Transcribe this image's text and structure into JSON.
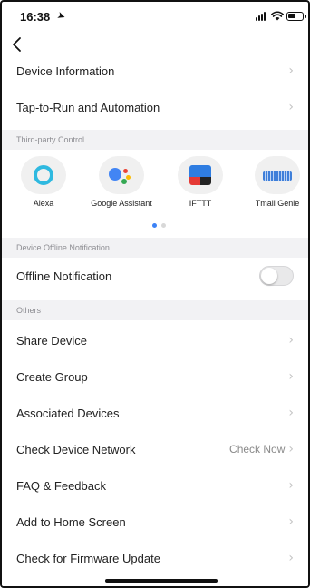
{
  "status_bar": {
    "time": "16:38",
    "location_icon": "location-arrow-icon",
    "signal_icon": "cellular-signal-icon",
    "wifi_icon": "wifi-icon",
    "battery_icon": "battery-icon"
  },
  "nav": {
    "back_icon": "chevron-left-icon"
  },
  "rows_top": [
    {
      "label": "Device Information",
      "chevron": "›"
    },
    {
      "label": "Tap-to-Run and Automation",
      "chevron": "›"
    }
  ],
  "third_party": {
    "header": "Third-party Control",
    "items": [
      {
        "label": "Alexa",
        "icon": "alexa-icon"
      },
      {
        "label": "Google Assistant",
        "icon": "google-assistant-icon"
      },
      {
        "label": "IFTTT",
        "icon": "ifttt-icon"
      },
      {
        "label": "Tmall Genie",
        "icon": "tmall-genie-icon"
      }
    ],
    "page_indicator": {
      "pages": 2,
      "active": 1
    }
  },
  "offline": {
    "header": "Device Offline Notification",
    "label": "Offline Notification",
    "enabled": false
  },
  "others": {
    "header": "Others",
    "rows": [
      {
        "label": "Share Device",
        "value": "",
        "chevron": "›"
      },
      {
        "label": "Create Group",
        "value": "",
        "chevron": "›"
      },
      {
        "label": "Associated Devices",
        "value": "",
        "chevron": "›"
      },
      {
        "label": "Check Device Network",
        "value": "Check Now",
        "chevron": "›"
      },
      {
        "label": "FAQ & Feedback",
        "value": "",
        "chevron": "›"
      },
      {
        "label": "Add to Home Screen",
        "value": "",
        "chevron": "›"
      },
      {
        "label": "Check for Firmware Update",
        "value": "",
        "chevron": "›"
      }
    ]
  },
  "colors": {
    "section_background": "#f2f2f4",
    "secondary_text": "#8e8e93",
    "chevron": "#c4c4c4",
    "alexa": "#2fb9e0",
    "page_dot_active": "#3b82f6",
    "page_dot_inactive": "#d8d8d8"
  }
}
